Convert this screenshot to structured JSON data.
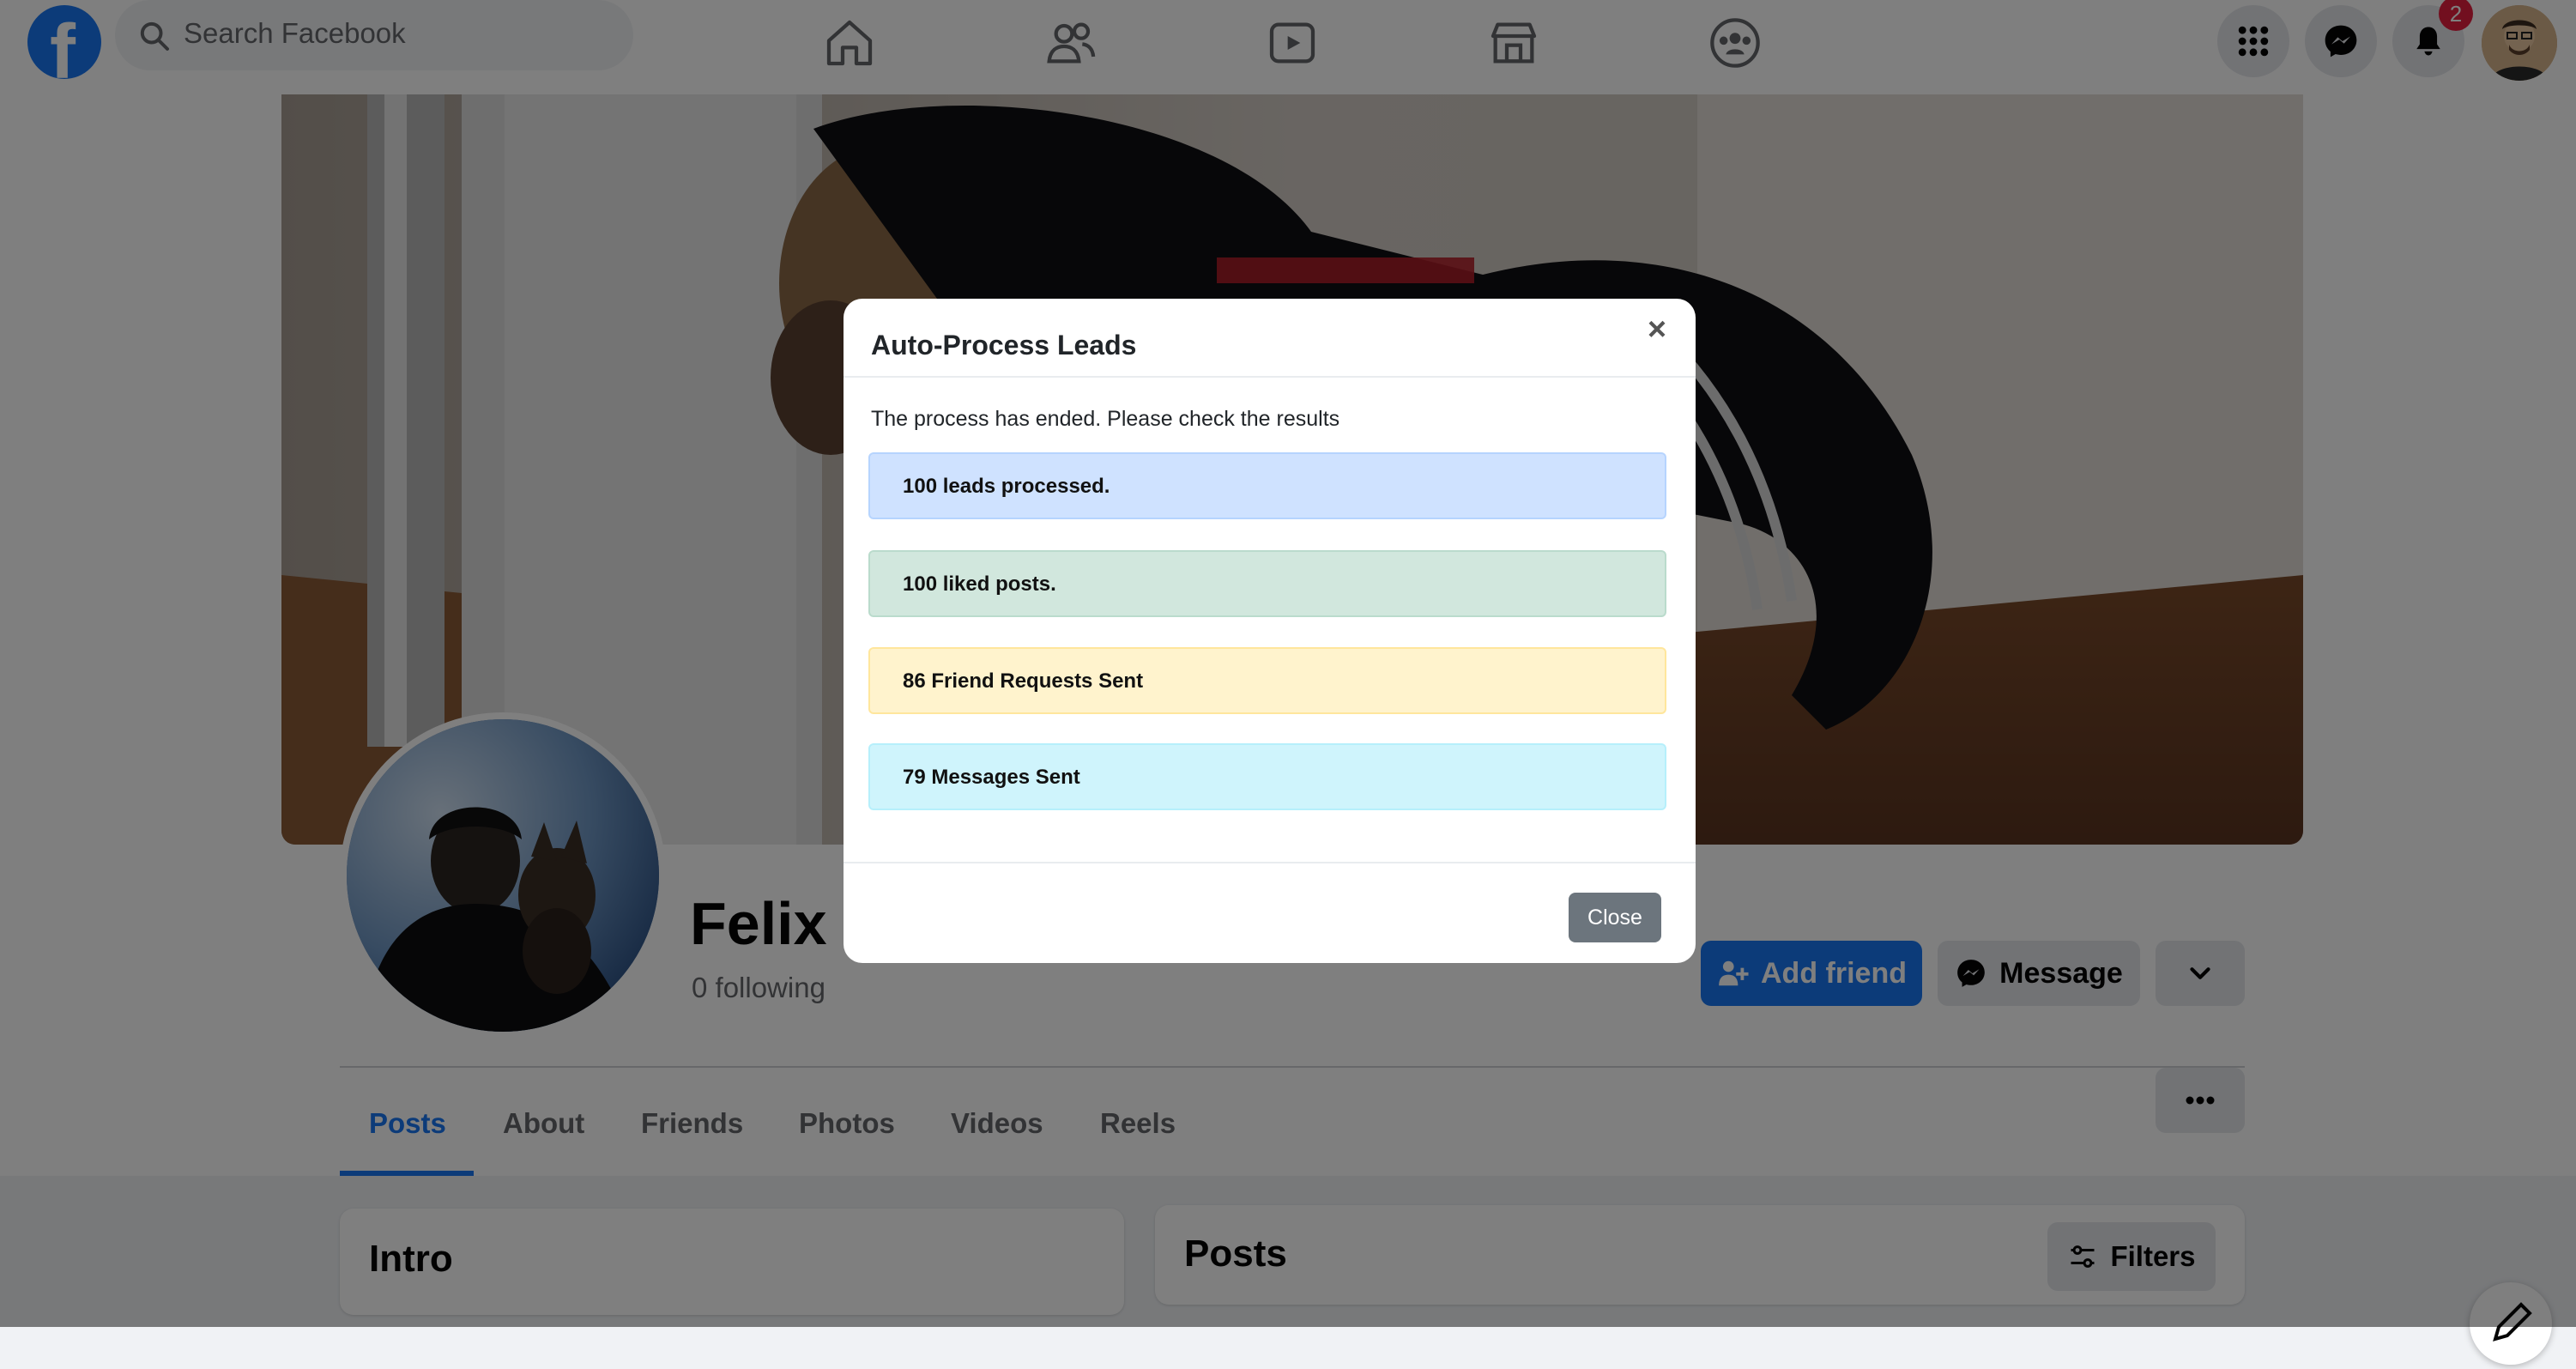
{
  "nav": {
    "search_placeholder": "Search Facebook",
    "notification_count": "2",
    "icons": [
      "home-icon",
      "friends-icon",
      "watch-icon",
      "marketplace-icon",
      "groups-icon",
      "menu-grid-icon",
      "messenger-icon",
      "bell-icon"
    ]
  },
  "profile": {
    "name": "Felix S",
    "following": "0 following",
    "add_friend_label": "Add friend",
    "message_label": "Message",
    "tabs": [
      "Posts",
      "About",
      "Friends",
      "Photos",
      "Videos",
      "Reels"
    ],
    "active_tab": "Posts"
  },
  "cards": {
    "intro_title": "Intro",
    "posts_title": "Posts",
    "filters_label": "Filters"
  },
  "modal": {
    "title": "Auto-Process Leads",
    "close_x": "×",
    "message": "The process has ended. Please check the results",
    "results": [
      {
        "text": "100 leads processed.",
        "color": "#cfe2ff"
      },
      {
        "text": "100 liked posts.",
        "color": "#d1e7dd"
      },
      {
        "text": "86 Friend Requests Sent",
        "color": "#fff3cd"
      },
      {
        "text": "79 Messages Sent",
        "color": "#cff4fc"
      }
    ],
    "close_label": "Close"
  },
  "colors": {
    "brand": "#1877f2",
    "badge": "#e41e3f",
    "secondary_button": "#6c757d"
  }
}
